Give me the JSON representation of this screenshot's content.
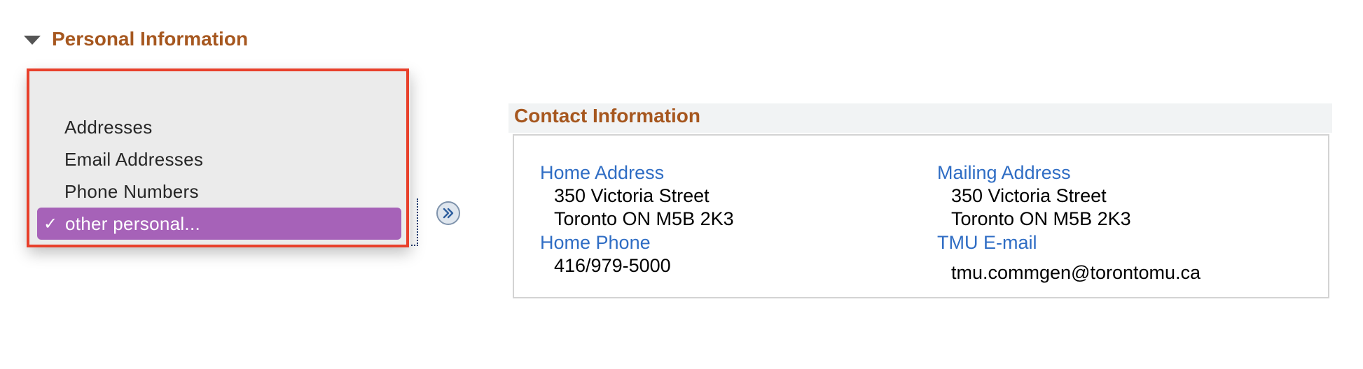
{
  "section": {
    "title": "Personal Information",
    "toggle_icon": "triangle-down-icon"
  },
  "dropdown": {
    "options": [
      {
        "label": "Addresses",
        "selected": false
      },
      {
        "label": "Email Addresses",
        "selected": false
      },
      {
        "label": "Phone Numbers",
        "selected": false
      },
      {
        "label": "other personal...",
        "selected": true
      }
    ],
    "check_mark": "✓",
    "highlight_color": "#a662b8",
    "frame_color": "#e8402b"
  },
  "go_button": {
    "icon": "double-chevron-right-icon"
  },
  "contact": {
    "title": "Contact Information",
    "home_address": {
      "label": "Home Address",
      "line1": "350 Victoria Street",
      "line2": "Toronto ON M5B 2K3"
    },
    "mailing_address": {
      "label": "Mailing Address",
      "line1": "350 Victoria Street",
      "line2": "Toronto ON M5B 2K3"
    },
    "home_phone": {
      "label": "Home Phone",
      "value": "416/979-5000"
    },
    "email": {
      "label": "TMU E-mail",
      "value": "tmu.commgen@torontomu.ca"
    },
    "label_color": "#2f6dc4",
    "title_color": "#a6571f"
  }
}
